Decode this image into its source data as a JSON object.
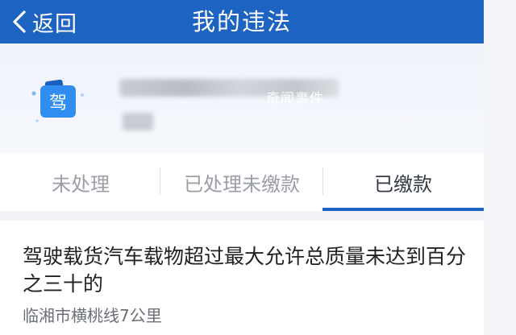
{
  "header": {
    "back_label": "返回",
    "title": "我的违法"
  },
  "user": {
    "badge_char": "驾",
    "watermark": "奇闻事件"
  },
  "tabs": [
    {
      "label": "未处理",
      "active": false
    },
    {
      "label": "已处理未缴款",
      "active": false
    },
    {
      "label": "已缴款",
      "active": true
    }
  ],
  "record": {
    "title": "驾驶载货汽车载物超过最大允许总质量未达到百分之三十的",
    "location": "临湘市横桃线7公里"
  },
  "colors": {
    "primary": "#1c63c2",
    "badge": "#2f8ef0"
  }
}
